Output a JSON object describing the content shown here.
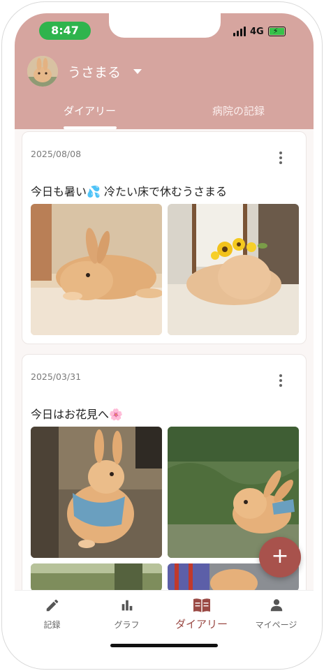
{
  "status_bar": {
    "time": "8:47",
    "network": "4G"
  },
  "header": {
    "pet_name": "うさまる",
    "tabs": [
      {
        "label": "ダイアリー",
        "active": true
      },
      {
        "label": "病院の記録",
        "active": false
      }
    ]
  },
  "diary_entries": [
    {
      "date": "2025/08/08",
      "text": "今日も暑い💦 冷たい床で休むうさまる",
      "photos": [
        "rabbit-lying-on-floor",
        "rabbit-with-sunflower-crown"
      ]
    },
    {
      "date": "2025/03/31",
      "text": "今日はお花見へ🌸",
      "photos": [
        "rabbit-in-harness-standing",
        "rabbit-in-grass",
        "rabbit-park-partial",
        "rabbit-plaid-partial"
      ]
    }
  ],
  "fab_label": "+",
  "bottom_nav": [
    {
      "label": "記録",
      "icon": "pencil-icon",
      "active": false
    },
    {
      "label": "グラフ",
      "icon": "bar-chart-icon",
      "active": false
    },
    {
      "label": "ダイアリー",
      "icon": "book-icon",
      "active": true
    },
    {
      "label": "マイページ",
      "icon": "person-icon",
      "active": false
    }
  ],
  "colors": {
    "header": "#d6a59f",
    "accent": "#a8524c",
    "active_nav": "#9a4944"
  }
}
